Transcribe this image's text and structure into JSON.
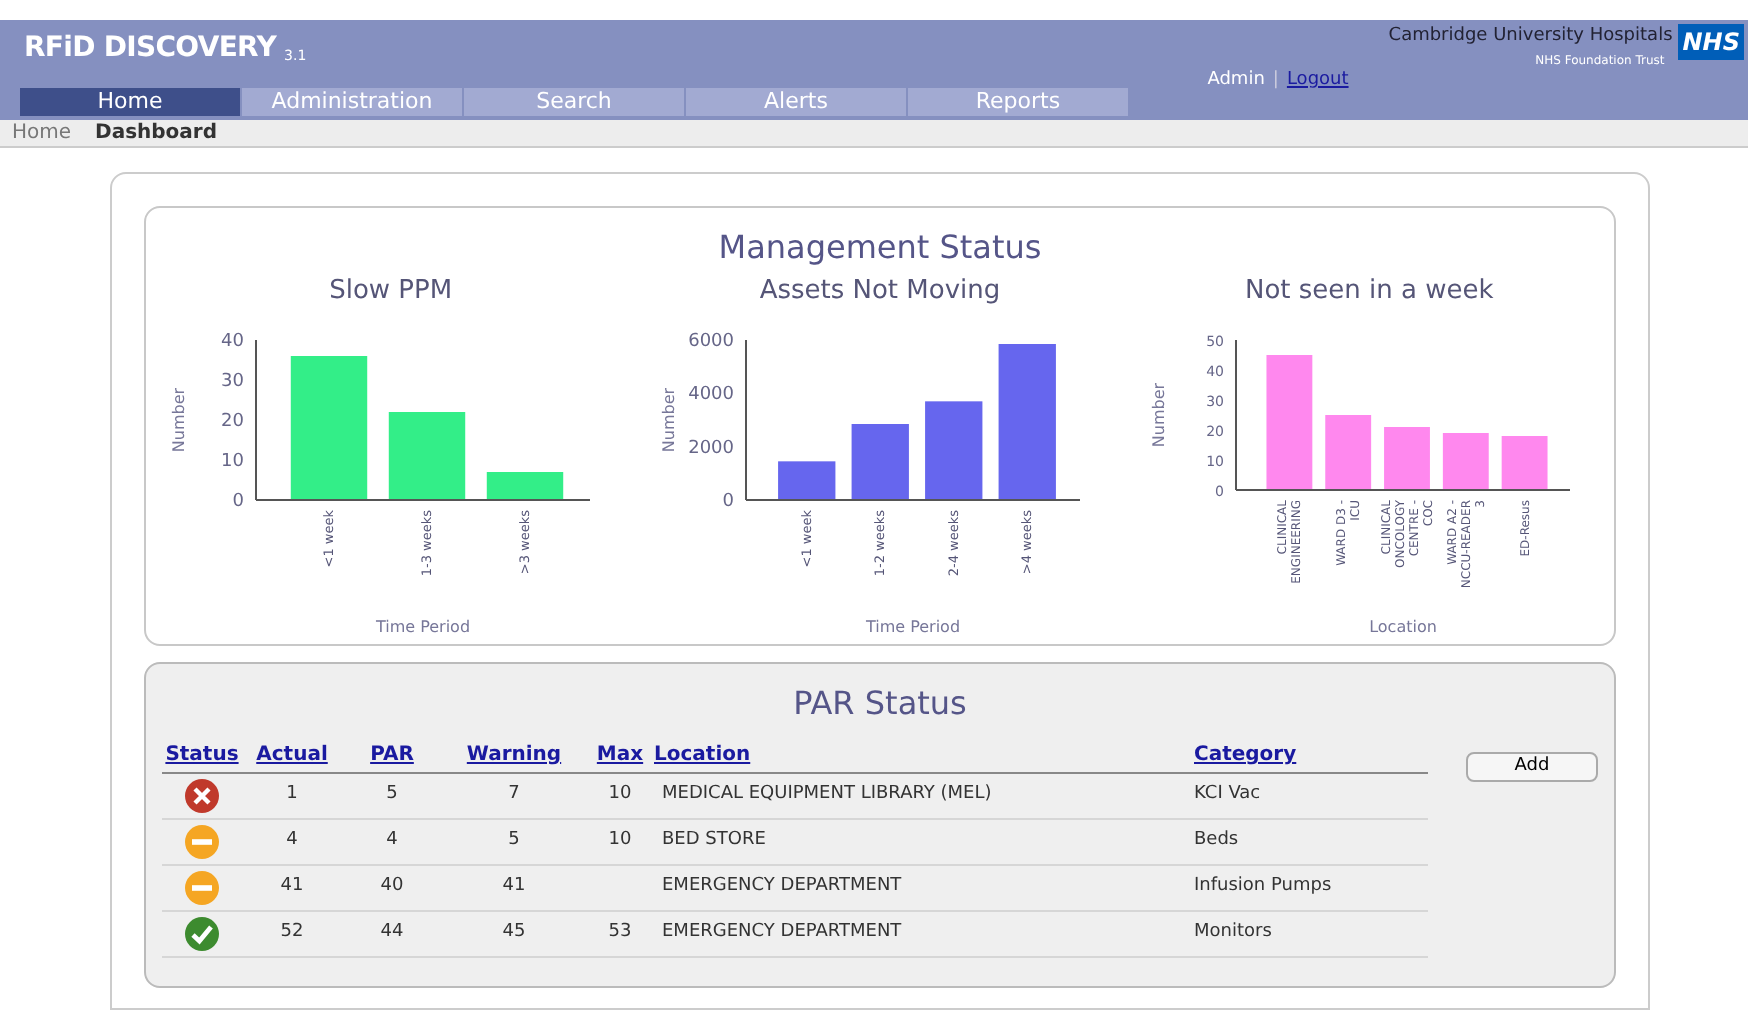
{
  "header": {
    "logo": "RFiD DISCOVERY",
    "logo_version": "3.1",
    "org_name": "Cambridge University Hospitals",
    "org_sub": "NHS Foundation Trust",
    "org_badge": "NHS",
    "user": "Admin",
    "separator": "|",
    "logout": "Logout"
  },
  "nav": [
    {
      "label": "Home",
      "selected": true
    },
    {
      "label": "Administration",
      "selected": false
    },
    {
      "label": "Search",
      "selected": false
    },
    {
      "label": "Alerts",
      "selected": false
    },
    {
      "label": "Reports",
      "selected": false
    }
  ],
  "breadcrumb": [
    {
      "label": "Home",
      "selected": false
    },
    {
      "label": "Dashboard",
      "selected": true
    }
  ],
  "management": {
    "title": "Management Status",
    "charts": [
      {
        "chart_data": {
          "type": "bar",
          "title": "Slow PPM",
          "xlabel": "Time Period",
          "ylabel": "Number",
          "categories": [
            "<1 week",
            "1-3 weeks",
            ">3 weeks"
          ],
          "series": [
            {
              "color": "#33ee88",
              "values": [
                36,
                22,
                7
              ]
            }
          ],
          "ylim": [
            0,
            40
          ],
          "yticks": [
            0,
            10,
            20,
            30,
            40
          ]
        }
      },
      {
        "chart_data": {
          "type": "bar",
          "title": "Assets Not Moving",
          "xlabel": "Time Period",
          "ylabel": "Number",
          "categories": [
            "<1 week",
            "1-2 weeks",
            "2-4 weeks",
            ">4 weeks"
          ],
          "series": [
            {
              "color": "#6666ee",
              "values": [
                1450,
                2850,
                3700,
                5850
              ]
            }
          ],
          "ylim": [
            0,
            6000
          ],
          "yticks": [
            0,
            2000,
            4000,
            6000
          ]
        }
      },
      {
        "chart_data": {
          "type": "bar",
          "title": "Not seen in a week",
          "xlabel": "Location",
          "ylabel": "Number",
          "categories": [
            "CLINICAL ENGINEERING",
            "WARD D3 - ICU",
            "CLINICAL ONCOLOGY CENTRE - COC",
            "WARD A2 - NCCU-READER 3",
            "ED-Resus"
          ],
          "series": [
            {
              "color": "#ff88ee",
              "values": [
                45,
                25,
                21,
                19,
                18
              ]
            }
          ],
          "ylim": [
            0,
            50
          ],
          "yticks": [
            0,
            10,
            20,
            30,
            40,
            50
          ]
        }
      }
    ]
  },
  "par": {
    "title": "PAR Status",
    "columns": [
      "Status",
      "Actual",
      "PAR",
      "Warning",
      "Max",
      "Location",
      "Category"
    ],
    "add_button": "Add",
    "rows": [
      {
        "kind": "error",
        "actual": "1",
        "par": "5",
        "warning": "7",
        "max": "10",
        "location": "MEDICAL EQUIPMENT LIBRARY (MEL)",
        "category": "KCI Vac"
      },
      {
        "kind": "warning",
        "actual": "4",
        "par": "4",
        "warning": "5",
        "max": "10",
        "location": "BED STORE",
        "category": "Beds"
      },
      {
        "kind": "warning",
        "actual": "41",
        "par": "40",
        "warning": "41",
        "location": "EMERGENCY DEPARTMENT",
        "category": "Infusion Pumps"
      },
      {
        "kind": "ok",
        "actual": "52",
        "par": "44",
        "warning": "45",
        "max": "53",
        "location": "EMERGENCY DEPARTMENT",
        "category": "Monitors"
      }
    ]
  }
}
